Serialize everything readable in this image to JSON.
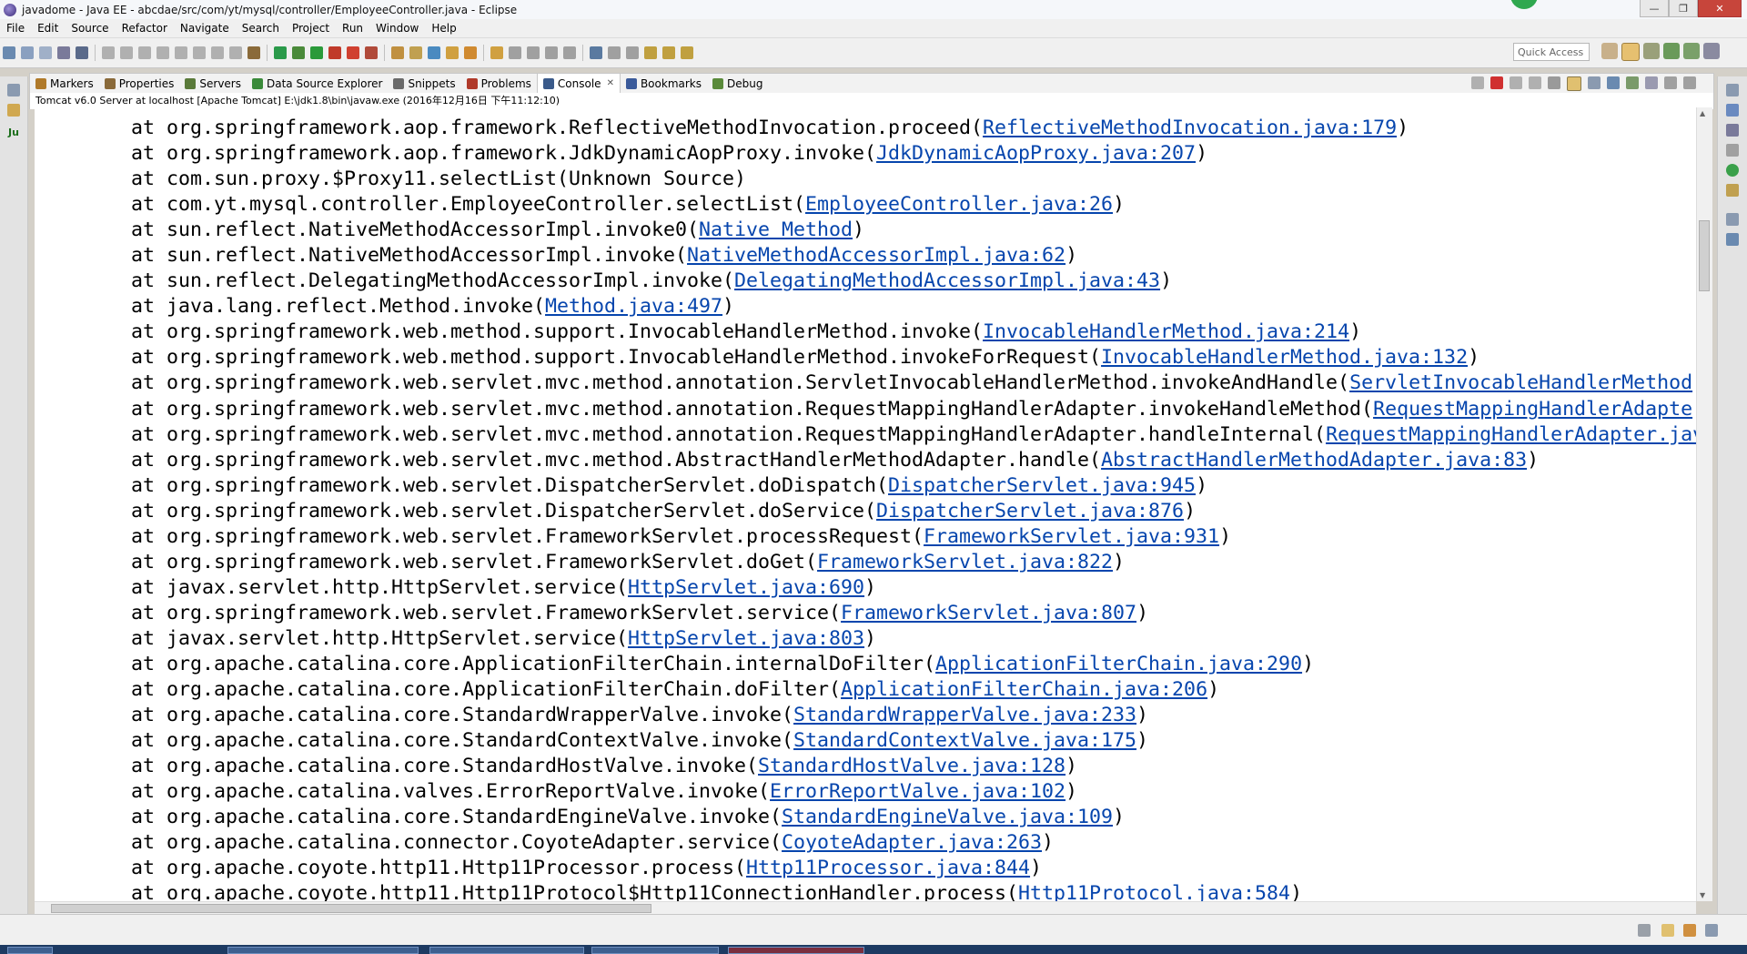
{
  "window": {
    "title": "javadome - Java EE - abcdae/src/com/yt/mysql/controller/EmployeeController.java - Eclipse",
    "controls": [
      "—",
      "❐",
      "✕"
    ]
  },
  "menu": [
    "File",
    "Edit",
    "Source",
    "Refactor",
    "Navigate",
    "Search",
    "Project",
    "Run",
    "Window",
    "Help"
  ],
  "quick_access": {
    "placeholder": "Quick Access"
  },
  "tabs": [
    {
      "label": "Markers",
      "icon": "markers-icon",
      "color": "#b07a2a"
    },
    {
      "label": "Properties",
      "icon": "properties-icon",
      "color": "#8a6a3a"
    },
    {
      "label": "Servers",
      "icon": "servers-icon",
      "color": "#5a7a3a"
    },
    {
      "label": "Data Source Explorer",
      "icon": "data-source-icon",
      "color": "#3a8a3a"
    },
    {
      "label": "Snippets",
      "icon": "snippets-icon",
      "color": "#6a6a6a"
    },
    {
      "label": "Problems",
      "icon": "problems-icon",
      "color": "#b03a2a"
    },
    {
      "label": "Console",
      "icon": "console-icon",
      "color": "#3a5a8a",
      "active": true
    },
    {
      "label": "Bookmarks",
      "icon": "bookmarks-icon",
      "color": "#3a5a9a"
    },
    {
      "label": "Debug",
      "icon": "debug-icon",
      "color": "#5a8a3a"
    }
  ],
  "console": {
    "process": "Tomcat v6.0 Server at localhost [Apache Tomcat] E:\\jdk1.8\\bin\\javaw.exe (2016年12月16日 下午11:12:10)",
    "lines": [
      {
        "text": "at org.springframework.aop.framework.ReflectiveMethodInvocation.proceed(",
        "link": "ReflectiveMethodInvocation.java:179",
        "end": ")"
      },
      {
        "text": "at org.springframework.aop.framework.JdkDynamicAopProxy.invoke(",
        "link": "JdkDynamicAopProxy.java:207",
        "end": ")"
      },
      {
        "text": "at com.sun.proxy.$Proxy11.selectList(Unknown Source)",
        "link": "",
        "end": ""
      },
      {
        "text": "at com.yt.mysql.controller.EmployeeController.selectList(",
        "link": "EmployeeController.java:26",
        "end": ")"
      },
      {
        "text": "at sun.reflect.NativeMethodAccessorImpl.invoke0(",
        "link": "Native Method",
        "end": ")"
      },
      {
        "text": "at sun.reflect.NativeMethodAccessorImpl.invoke(",
        "link": "NativeMethodAccessorImpl.java:62",
        "end": ")"
      },
      {
        "text": "at sun.reflect.DelegatingMethodAccessorImpl.invoke(",
        "link": "DelegatingMethodAccessorImpl.java:43",
        "end": ")"
      },
      {
        "text": "at java.lang.reflect.Method.invoke(",
        "link": "Method.java:497",
        "end": ")"
      },
      {
        "text": "at org.springframework.web.method.support.InvocableHandlerMethod.invoke(",
        "link": "InvocableHandlerMethod.java:214",
        "end": ")"
      },
      {
        "text": "at org.springframework.web.method.support.InvocableHandlerMethod.invokeForRequest(",
        "link": "InvocableHandlerMethod.java:132",
        "end": ")"
      },
      {
        "text": "at org.springframework.web.servlet.mvc.method.annotation.ServletInvocableHandlerMethod.invokeAndHandle(",
        "link": "ServletInvocableHandlerMethod",
        "end": ""
      },
      {
        "text": "at org.springframework.web.servlet.mvc.method.annotation.RequestMappingHandlerAdapter.invokeHandleMethod(",
        "link": "RequestMappingHandlerAdapte",
        "end": ""
      },
      {
        "text": "at org.springframework.web.servlet.mvc.method.annotation.RequestMappingHandlerAdapter.handleInternal(",
        "link": "RequestMappingHandlerAdapter.jav",
        "end": ""
      },
      {
        "text": "at org.springframework.web.servlet.mvc.method.AbstractHandlerMethodAdapter.handle(",
        "link": "AbstractHandlerMethodAdapter.java:83",
        "end": ")"
      },
      {
        "text": "at org.springframework.web.servlet.DispatcherServlet.doDispatch(",
        "link": "DispatcherServlet.java:945",
        "end": ")"
      },
      {
        "text": "at org.springframework.web.servlet.DispatcherServlet.doService(",
        "link": "DispatcherServlet.java:876",
        "end": ")"
      },
      {
        "text": "at org.springframework.web.servlet.FrameworkServlet.processRequest(",
        "link": "FrameworkServlet.java:931",
        "end": ")"
      },
      {
        "text": "at org.springframework.web.servlet.FrameworkServlet.doGet(",
        "link": "FrameworkServlet.java:822",
        "end": ")"
      },
      {
        "text": "at javax.servlet.http.HttpServlet.service(",
        "link": "HttpServlet.java:690",
        "end": ")"
      },
      {
        "text": "at org.springframework.web.servlet.FrameworkServlet.service(",
        "link": "FrameworkServlet.java:807",
        "end": ")"
      },
      {
        "text": "at javax.servlet.http.HttpServlet.service(",
        "link": "HttpServlet.java:803",
        "end": ")"
      },
      {
        "text": "at org.apache.catalina.core.ApplicationFilterChain.internalDoFilter(",
        "link": "ApplicationFilterChain.java:290",
        "end": ")"
      },
      {
        "text": "at org.apache.catalina.core.ApplicationFilterChain.doFilter(",
        "link": "ApplicationFilterChain.java:206",
        "end": ")"
      },
      {
        "text": "at org.apache.catalina.core.StandardWrapperValve.invoke(",
        "link": "StandardWrapperValve.java:233",
        "end": ")"
      },
      {
        "text": "at org.apache.catalina.core.StandardContextValve.invoke(",
        "link": "StandardContextValve.java:175",
        "end": ")"
      },
      {
        "text": "at org.apache.catalina.core.StandardHostValve.invoke(",
        "link": "StandardHostValve.java:128",
        "end": ")"
      },
      {
        "text": "at org.apache.catalina.valves.ErrorReportValve.invoke(",
        "link": "ErrorReportValve.java:102",
        "end": ")"
      },
      {
        "text": "at org.apache.catalina.core.StandardEngineValve.invoke(",
        "link": "StandardEngineValve.java:109",
        "end": ")"
      },
      {
        "text": "at org.apache.catalina.connector.CoyoteAdapter.service(",
        "link": "CoyoteAdapter.java:263",
        "end": ")"
      },
      {
        "text": "at org.apache.coyote.http11.Http11Processor.process(",
        "link": "Http11Processor.java:844",
        "end": ")"
      },
      {
        "text": "at org.apache.coyote.http11.Http11Protocol$Http11ConnectionHandler.process(",
        "link": "Http11Protocol.java:584",
        "end": ")"
      }
    ]
  },
  "toolbar_icons": [
    {
      "name": "new-icon",
      "color": "#6a8ab0"
    },
    {
      "name": "save-icon",
      "color": "#8aa0c0"
    },
    {
      "name": "save-all-icon",
      "color": "#a0b0c8"
    },
    {
      "name": "print-icon",
      "color": "#7a7a9a"
    },
    {
      "name": "terminal-icon",
      "color": "#5a6a8a"
    },
    {
      "name": "resume-icon",
      "color": "#b0b0b0"
    },
    {
      "name": "suspend-icon",
      "color": "#b0b0b0"
    },
    {
      "name": "terminate-icon",
      "color": "#b0b0b0"
    },
    {
      "name": "disconnect-icon",
      "color": "#b0b0b0"
    },
    {
      "name": "step-into-icon",
      "color": "#b0b0b0"
    },
    {
      "name": "step-over-icon",
      "color": "#b0b0b0"
    },
    {
      "name": "step-return-icon",
      "color": "#b0b0b0"
    },
    {
      "name": "drop-to-frame-icon",
      "color": "#b0b0b0"
    },
    {
      "name": "use-step-filters-icon",
      "color": "#8a6a3a"
    },
    {
      "name": "server-start-icon",
      "color": "#2a9a4a"
    },
    {
      "name": "debug-run-icon",
      "color": "#4a8a3a"
    },
    {
      "name": "run-icon",
      "color": "#2a9a3a"
    },
    {
      "name": "coverage-icon",
      "color": "#c03a2a"
    },
    {
      "name": "external-tools-icon",
      "color": "#d04030"
    },
    {
      "name": "new-server-icon",
      "color": "#b04a3a"
    },
    {
      "name": "new-java-project-icon",
      "color": "#c09040"
    },
    {
      "name": "new-package-icon",
      "color": "#c0a050"
    },
    {
      "name": "new-class-icon",
      "color": "#4a8ac0"
    },
    {
      "name": "open-type-icon",
      "color": "#d0a040"
    },
    {
      "name": "open-task-icon",
      "color": "#d08a30"
    },
    {
      "name": "search-icon",
      "color": "#d0a040"
    },
    {
      "name": "annotation-icon",
      "color": "#a0a0a0"
    },
    {
      "name": "toggle-mark-icon",
      "color": "#a0a0a0"
    },
    {
      "name": "block-selection-icon",
      "color": "#a0a0a0"
    },
    {
      "name": "show-whitespace-icon",
      "color": "#a0a0a0"
    },
    {
      "name": "globe-icon",
      "color": "#5a7aa0"
    },
    {
      "name": "next-annotation-icon",
      "color": "#a0a0a0"
    },
    {
      "name": "prev-annotation-icon",
      "color": "#a0a0a0"
    },
    {
      "name": "last-edit-icon",
      "color": "#c0a040"
    },
    {
      "name": "back-icon",
      "color": "#c0a040"
    },
    {
      "name": "forward-icon",
      "color": "#c0a040"
    }
  ]
}
